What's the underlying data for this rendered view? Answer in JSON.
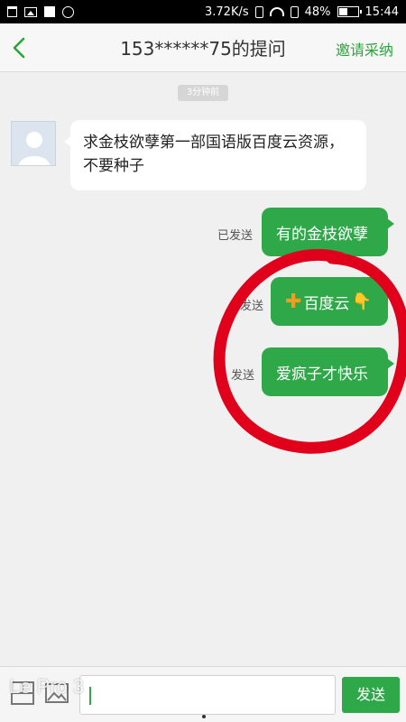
{
  "status_bar": {
    "network_speed": "3.72K/s",
    "battery_percent": "48%",
    "battery_level": 0.48,
    "time": "15:44",
    "icons": [
      "trash-icon",
      "image-icon",
      "square-icon",
      "message-icon",
      "vibrate-icon",
      "wifi-icon",
      "sim-icon",
      "battery-icon"
    ]
  },
  "header": {
    "title": "153******75的提问",
    "invite_label": "邀请采纳",
    "accent_color": "#2aa53a"
  },
  "chat": {
    "timestamp": "3分钟前",
    "incoming": {
      "text": "求金枝欲孽第一部国语版百度云资源，不要种子"
    },
    "outgoing": [
      {
        "status": "已发送",
        "text": "有的金枝欲孽"
      },
      {
        "status": "发送",
        "text": "百度云",
        "prefix_emoji": "plus-emoji",
        "suffix_emoji": "pointing-down-emoji"
      },
      {
        "status": "发送",
        "text": "爱疯子才快乐"
      }
    ],
    "bubble_color": "#2fa84a",
    "annotation_color": "#e0001b"
  },
  "input_bar": {
    "input_value": "",
    "send_label": "发送",
    "watermark": "Le Pro 3"
  }
}
